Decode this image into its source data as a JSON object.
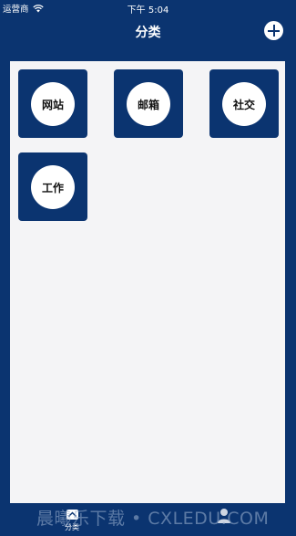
{
  "status_bar": {
    "carrier": "运营商",
    "time": "下午 5:04"
  },
  "nav": {
    "title": "分类",
    "add_icon": "plus-circle-icon"
  },
  "categories": [
    {
      "label": "网站"
    },
    {
      "label": "邮箱"
    },
    {
      "label": "社交"
    },
    {
      "label": "工作"
    }
  ],
  "tab_bar": {
    "items": [
      {
        "label": "分类",
        "icon": "category-icon"
      },
      {
        "label": "",
        "icon": "profile-icon"
      }
    ]
  },
  "watermark": "晨曦乐下载 • CXLEDU.COM",
  "colors": {
    "primary": "#0b3470",
    "panel_background": "#f4f4f6",
    "tile_circle": "#ffffff"
  }
}
